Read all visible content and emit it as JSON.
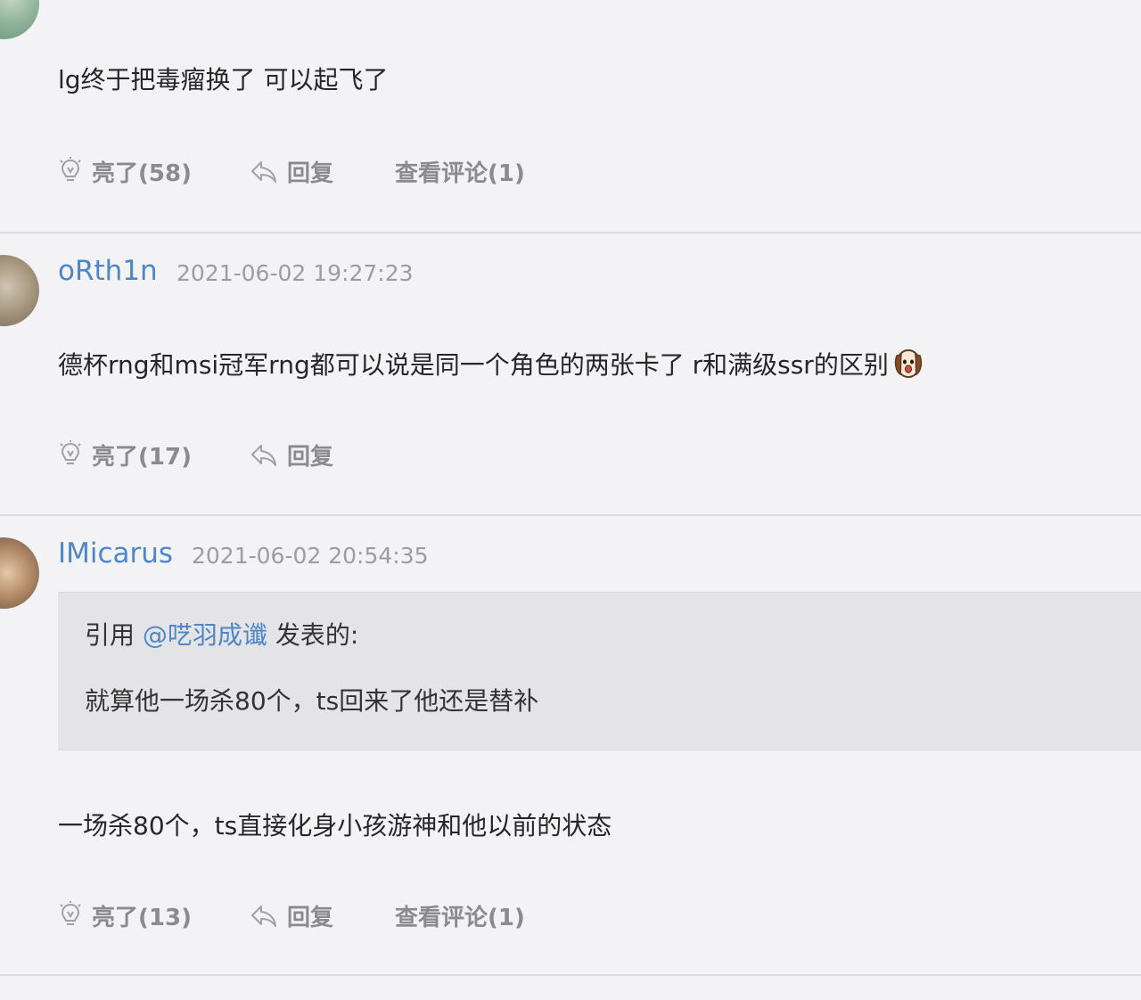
{
  "comments": [
    {
      "username": "",
      "timestamp": "",
      "body": "lg终于把毒瘤换了 可以起飞了",
      "actions": {
        "like_label": "亮了(58)",
        "reply_label": "回复",
        "view_label": "查看评论(1)"
      }
    },
    {
      "username": "oRth1n",
      "timestamp": "2021-06-02 19:27:23",
      "body": "德杯rng和msi冠军rng都可以说是同一个角色的两张卡了 r和满级ssr的区别",
      "emoji": "dog-face-emoji",
      "actions": {
        "like_label": "亮了(17)",
        "reply_label": "回复"
      }
    },
    {
      "username": "IMicarus",
      "timestamp": "2021-06-02 20:54:35",
      "quote": {
        "prefix": "引用 ",
        "mention": "@呓羽成谶",
        "suffix": " 发表的:",
        "text": "就算他一场杀80个，ts回来了他还是替补"
      },
      "body": "一场杀80个，ts直接化身小孩游神和他以前的状态",
      "actions": {
        "like_label": "亮了(13)",
        "reply_label": "回复",
        "view_label": "查看评论(1)"
      }
    }
  ],
  "icons": {
    "like": "lightbulb-icon",
    "reply": "reply-arrow-icon"
  },
  "colors": {
    "background": "#f3f3f5",
    "username": "#4e86c6",
    "action_text": "#8a8a90",
    "quote_background": "#e4e4e6",
    "divider": "#dcdcdf"
  }
}
